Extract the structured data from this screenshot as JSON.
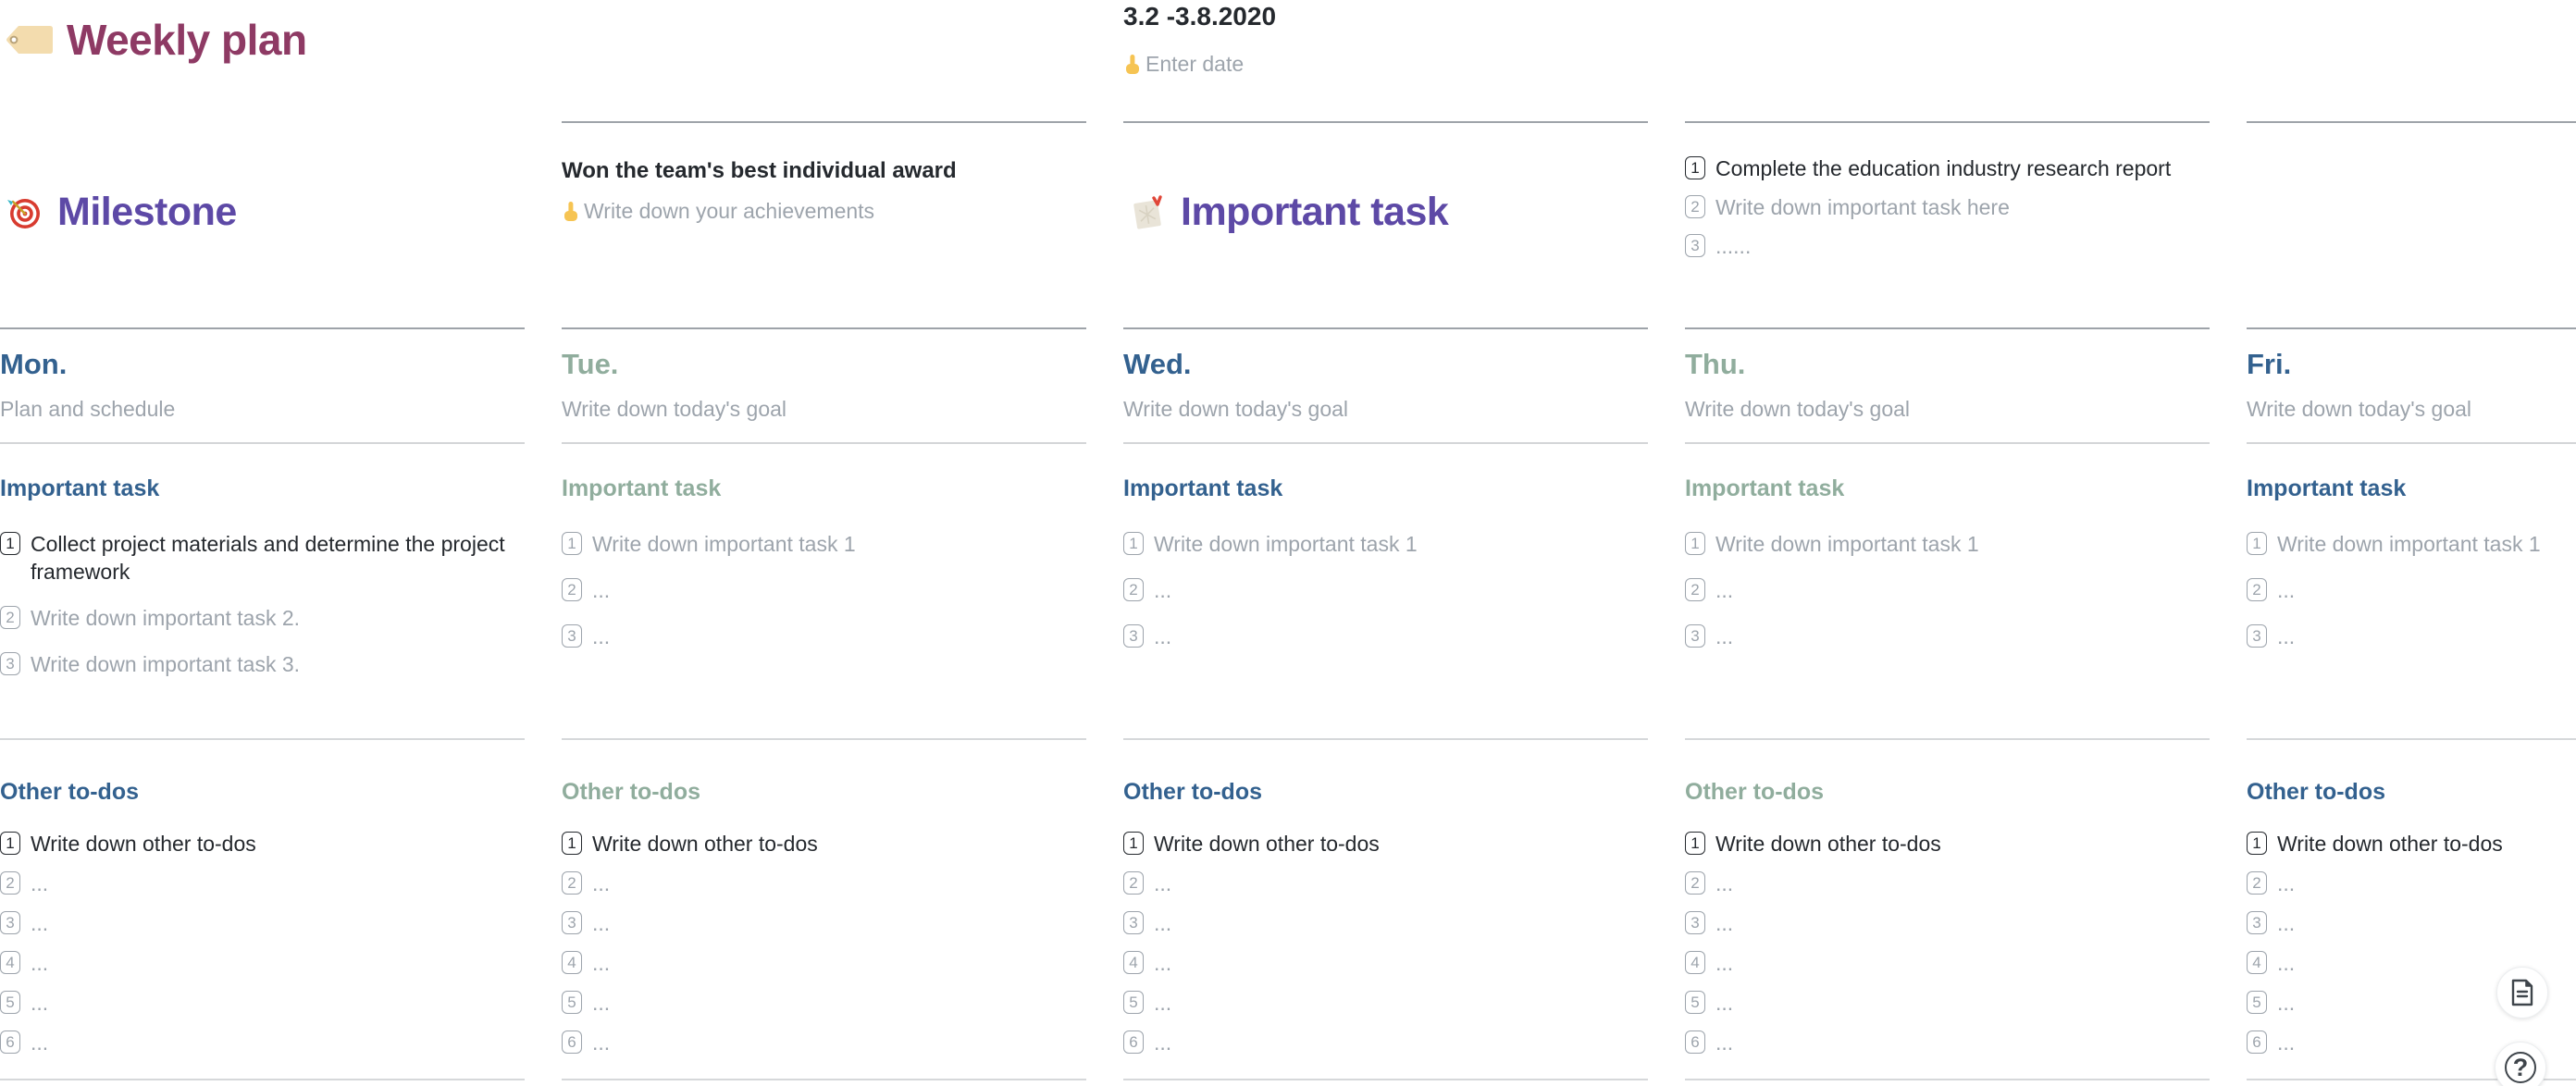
{
  "page": {
    "title": "Weekly plan",
    "date_range": "3.2 -3.8.2020",
    "date_placeholder": "Enter date"
  },
  "milestone": {
    "heading": "Milestone",
    "achievement": "Won the team's best individual award",
    "achievement_placeholder": "Write down your achievements"
  },
  "important_task": {
    "heading": "Important task",
    "items": [
      {
        "num": "1",
        "text": "Complete the education industry research report",
        "muted": false
      },
      {
        "num": "2",
        "text": "Write down important task here",
        "muted": true
      },
      {
        "num": "3",
        "text": "......",
        "muted": true
      }
    ]
  },
  "days": [
    {
      "name": "Mon.",
      "theme": "blue",
      "goal": "Plan and schedule",
      "important_heading": "Important task",
      "important_items": [
        {
          "num": "1",
          "text": "Collect project materials and determine the project framework",
          "muted": false
        },
        {
          "num": "2",
          "text": "Write down important task 2.",
          "muted": true
        },
        {
          "num": "3",
          "text": "Write down important task 3.",
          "muted": true
        }
      ],
      "todos_heading": "Other to-dos",
      "todo_items": [
        {
          "num": "1",
          "text": "Write down other to-dos",
          "muted": false
        },
        {
          "num": "2",
          "text": "...",
          "muted": true
        },
        {
          "num": "3",
          "text": "...",
          "muted": true
        },
        {
          "num": "4",
          "text": "...",
          "muted": true
        },
        {
          "num": "5",
          "text": "...",
          "muted": true
        },
        {
          "num": "6",
          "text": "...",
          "muted": true
        }
      ]
    },
    {
      "name": "Tue.",
      "theme": "green",
      "goal": "Write down today's goal",
      "important_heading": "Important task",
      "important_items": [
        {
          "num": "1",
          "text": "Write down important task 1",
          "muted": true
        },
        {
          "num": "2",
          "text": "...",
          "muted": true
        },
        {
          "num": "3",
          "text": "...",
          "muted": true
        }
      ],
      "todos_heading": "Other to-dos",
      "todo_items": [
        {
          "num": "1",
          "text": "Write down other to-dos",
          "muted": false
        },
        {
          "num": "2",
          "text": "...",
          "muted": true
        },
        {
          "num": "3",
          "text": "...",
          "muted": true
        },
        {
          "num": "4",
          "text": "...",
          "muted": true
        },
        {
          "num": "5",
          "text": "...",
          "muted": true
        },
        {
          "num": "6",
          "text": "...",
          "muted": true
        }
      ]
    },
    {
      "name": "Wed.",
      "theme": "blue",
      "goal": "Write down today's goal",
      "important_heading": "Important task",
      "important_items": [
        {
          "num": "1",
          "text": "Write down important task 1",
          "muted": true
        },
        {
          "num": "2",
          "text": "...",
          "muted": true
        },
        {
          "num": "3",
          "text": "...",
          "muted": true
        }
      ],
      "todos_heading": "Other to-dos",
      "todo_items": [
        {
          "num": "1",
          "text": "Write down other to-dos",
          "muted": false
        },
        {
          "num": "2",
          "text": "...",
          "muted": true
        },
        {
          "num": "3",
          "text": "...",
          "muted": true
        },
        {
          "num": "4",
          "text": "...",
          "muted": true
        },
        {
          "num": "5",
          "text": "...",
          "muted": true
        },
        {
          "num": "6",
          "text": "...",
          "muted": true
        }
      ]
    },
    {
      "name": "Thu.",
      "theme": "green",
      "goal": "Write down today's goal",
      "important_heading": "Important task",
      "important_items": [
        {
          "num": "1",
          "text": "Write down important task 1",
          "muted": true
        },
        {
          "num": "2",
          "text": "...",
          "muted": true
        },
        {
          "num": "3",
          "text": "...",
          "muted": true
        }
      ],
      "todos_heading": "Other to-dos",
      "todo_items": [
        {
          "num": "1",
          "text": "Write down other to-dos",
          "muted": false
        },
        {
          "num": "2",
          "text": "...",
          "muted": true
        },
        {
          "num": "3",
          "text": "...",
          "muted": true
        },
        {
          "num": "4",
          "text": "...",
          "muted": true
        },
        {
          "num": "5",
          "text": "...",
          "muted": true
        },
        {
          "num": "6",
          "text": "...",
          "muted": true
        }
      ]
    },
    {
      "name": "Fri.",
      "theme": "blue",
      "goal": "Write down today's goal",
      "important_heading": "Important task",
      "important_items": [
        {
          "num": "1",
          "text": "Write down important task 1",
          "muted": true
        },
        {
          "num": "2",
          "text": "...",
          "muted": true
        },
        {
          "num": "3",
          "text": "...",
          "muted": true
        }
      ],
      "todos_heading": "Other to-dos",
      "todo_items": [
        {
          "num": "1",
          "text": "Write down other to-dos",
          "muted": false
        },
        {
          "num": "2",
          "text": "...",
          "muted": true
        },
        {
          "num": "3",
          "text": "...",
          "muted": true
        },
        {
          "num": "4",
          "text": "...",
          "muted": true
        },
        {
          "num": "5",
          "text": "...",
          "muted": true
        },
        {
          "num": "6",
          "text": "...",
          "muted": true
        }
      ]
    }
  ],
  "floating": {
    "help_label": "?"
  },
  "colors": {
    "title": "#8E3A64",
    "section_heading": "#5D49A6",
    "day_blue": "#33618F",
    "day_green": "#90AD9D",
    "text_dark": "#25292E",
    "text_muted": "#9DA4AC",
    "divider_dark": "#9EA3A9",
    "divider_light": "#D6D8DA"
  }
}
